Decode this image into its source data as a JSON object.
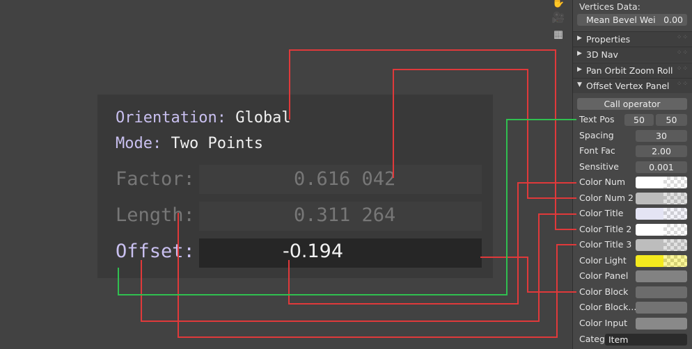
{
  "overlay": {
    "orientation_key": "Orientation:",
    "orientation_val": "Global",
    "mode_key": "Mode:",
    "mode_val": "Two Points",
    "factor_key": "Factor:",
    "factor_val": "0.616 042",
    "length_key": "Length:",
    "length_val": "0.311 264",
    "offset_key": "Offset:",
    "offset_val": "-0.194"
  },
  "viewport_icons": [
    "hand-icon",
    "camera-icon",
    "grid-icon"
  ],
  "panel": {
    "vertices_data_label": "Vertices Data:",
    "mean_bevel_label": "Mean Bevel Wei",
    "mean_bevel_value": "0.00",
    "sections": [
      {
        "label": "Properties",
        "collapsed": true
      },
      {
        "label": "3D Nav",
        "collapsed": true
      },
      {
        "label": "Pan Orbit Zoom Roll",
        "collapsed": true
      },
      {
        "label": "Offset Vertex Panel",
        "collapsed": false
      }
    ],
    "call_operator_label": "Call operator",
    "text_pos": {
      "label": "Text Pos",
      "x": "50",
      "y": "50"
    },
    "spacing": {
      "label": "Spacing",
      "value": "30"
    },
    "font_fac": {
      "label": "Font Fac",
      "value": "2.00"
    },
    "sensitive": {
      "label": "Sensitive",
      "value": "0.001"
    },
    "colors": [
      {
        "label": "Color Num",
        "color": "#ffffff",
        "alpha": true
      },
      {
        "label": "Color Num 2",
        "color": "#bcbcbc",
        "alpha": true
      },
      {
        "label": "Color Title",
        "color": "#e4e4f4",
        "alpha": true
      },
      {
        "label": "Color Title 2",
        "color": "#ffffff",
        "alpha": true
      },
      {
        "label": "Color Title 3",
        "color": "#bdbdbd",
        "alpha": true
      },
      {
        "label": "Color Light",
        "color": "#f4ea1e",
        "alpha": true
      },
      {
        "label": "Color Panel",
        "color": "#828282",
        "alpha": false
      },
      {
        "label": "Color Block",
        "color": "#6c6c6c",
        "alpha": false
      },
      {
        "label": "Color Block...",
        "color": "#737373",
        "alpha": false
      },
      {
        "label": "Color Input",
        "color": "#898989",
        "alpha": false
      }
    ],
    "category": {
      "label": "Categ",
      "value": "Item"
    }
  },
  "accent_colors": {
    "red_line": "#e0393a",
    "green_line": "#30c050"
  }
}
